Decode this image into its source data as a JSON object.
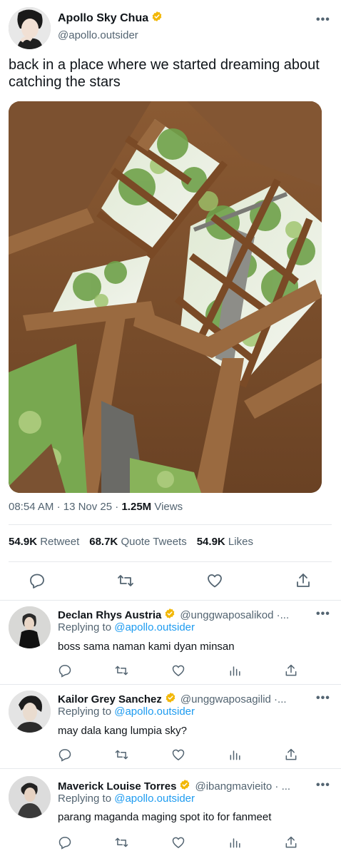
{
  "tweet": {
    "author_name": "Apollo Sky Chua",
    "author_handle": "@apollo.outsider",
    "text": "back in a place where we started dreaming about catching the stars",
    "time": "08:54 AM",
    "date": "13 Nov 25",
    "views_count": "1.25M",
    "views_label": "Views",
    "separator": "·",
    "stats": [
      {
        "count": "54.9K",
        "label": "Retweet"
      },
      {
        "count": "68.7K",
        "label": "Quote Tweets"
      },
      {
        "count": "54.9K",
        "label": "Likes"
      }
    ],
    "more": "•••",
    "media": "photo of a wooden treehouse roof skylight with tree branches and green leaves visible through it"
  },
  "replies": [
    {
      "name": "Declan Rhys Austria",
      "handle": "@unggwaposalikod ·...",
      "replying_prefix": "Replying to",
      "replying_to": "@apollo.outsider",
      "text": "boss sama naman kami dyan minsan",
      "more": "•••"
    },
    {
      "name": "Kailor Grey Sanchez",
      "handle": "@unggwaposagilid ·...",
      "replying_prefix": "Replying to",
      "replying_to": "@apollo.outsider",
      "text": "may dala kang lumpia sky?",
      "more": "•••"
    },
    {
      "name": "Maverick Louise Torres",
      "handle": "@ibangmavieito · ...",
      "replying_prefix": "Replying to",
      "replying_to": "@apollo.outsider",
      "text": "parang maganda maging spot ito for fanmeet",
      "more": "•••"
    }
  ],
  "colors": {
    "verified": "#f2b705",
    "link": "#1d9bf0",
    "secondary_text": "#536471",
    "primary_text": "#0f1419",
    "divider": "#e6e9ec"
  },
  "icons": {
    "main_actions": [
      "reply-icon",
      "retweet-icon",
      "like-icon",
      "share-icon"
    ],
    "reply_actions": [
      "reply-icon",
      "retweet-icon",
      "like-icon",
      "views-icon",
      "share-icon"
    ]
  }
}
